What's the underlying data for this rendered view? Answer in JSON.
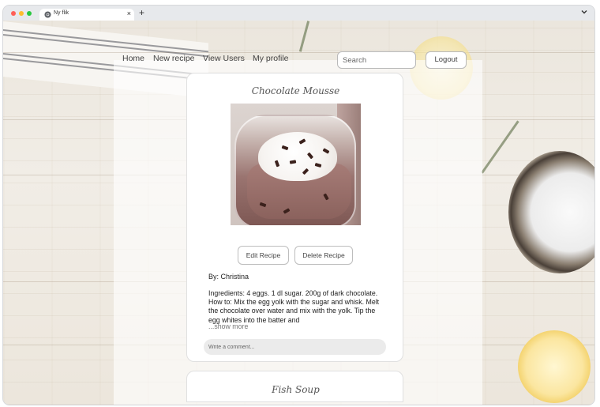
{
  "browser": {
    "tab_title": "Ny flik",
    "tab_close": "×",
    "new_tab": "+",
    "menu_icon": "chevron-down-icon"
  },
  "nav": {
    "links": [
      "Home",
      "New recipe",
      "View Users",
      "My profile"
    ],
    "search_placeholder": "Search",
    "logout_label": "Logout"
  },
  "recipes": [
    {
      "title": "Chocolate Mousse",
      "edit_label": "Edit Recipe",
      "delete_label": "Delete Recipe",
      "author": "By: Christina",
      "ingredients": "Ingredients: 4 eggs. 1 dl sugar. 200g of dark chocolate. How to: Mix the egg yolk with the sugar and whisk. Melt the chocolate over water and mix with the yolk. Tip the egg whites into the batter and",
      "show_more": "...show more",
      "comment_placeholder": "Write a comment..."
    },
    {
      "title": "Fish Soup"
    }
  ]
}
